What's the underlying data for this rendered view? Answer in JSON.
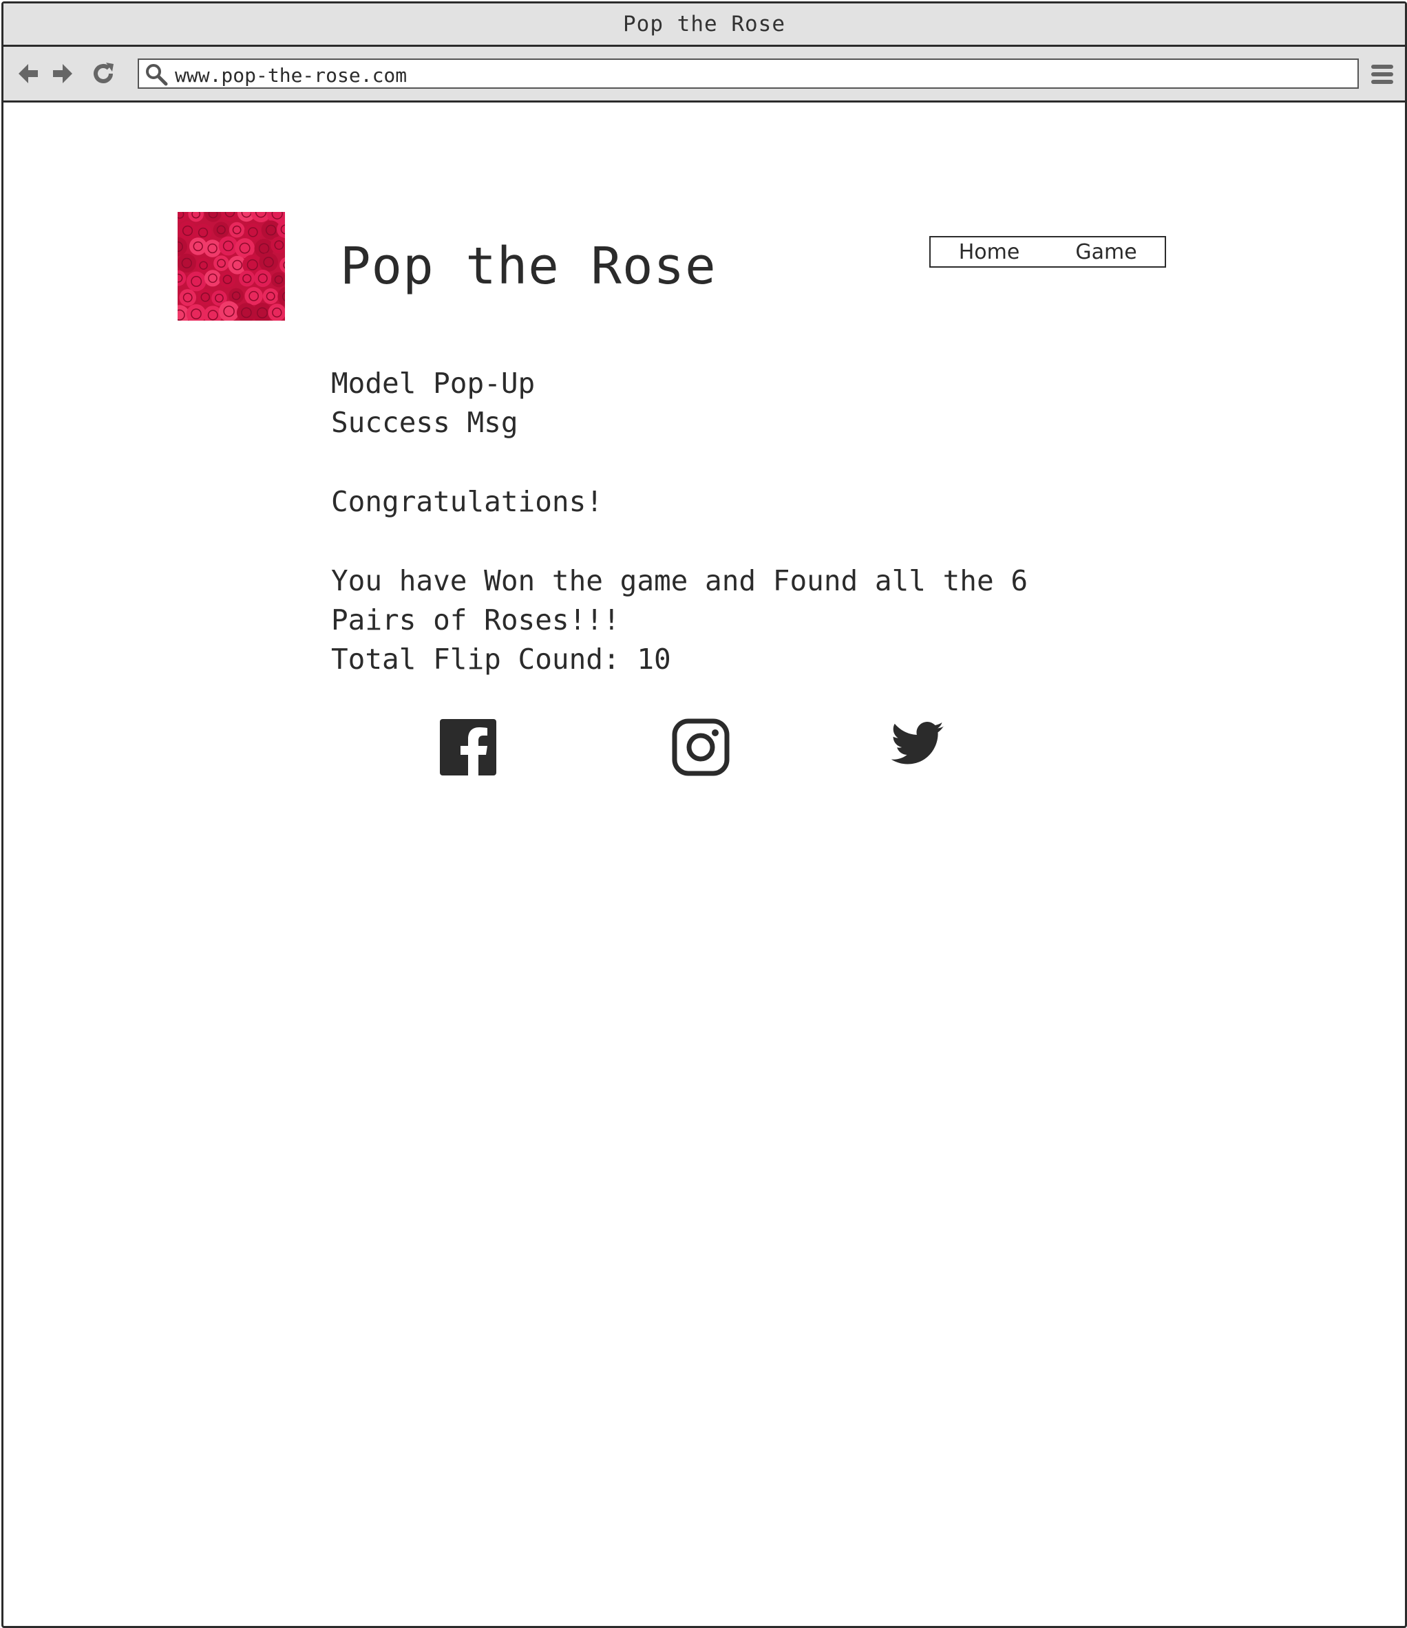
{
  "window": {
    "title": "Pop the Rose"
  },
  "browser": {
    "url": "www.pop-the-rose.com",
    "icons": {
      "back": "arrow-left-icon",
      "forward": "arrow-right-icon",
      "reload": "reload-icon",
      "search": "search-icon",
      "menu": "hamburger-menu-icon"
    }
  },
  "header": {
    "logo": "rose-image",
    "title": "Pop the Rose",
    "nav": [
      {
        "label": "Home"
      },
      {
        "label": "Game"
      }
    ]
  },
  "modal": {
    "heading_line1": "Model Pop-Up",
    "heading_line2": "Success Msg",
    "congrats": "Congratulations!",
    "message_line1": "You have Won the game and Found all the 6",
    "message_line2": "Pairs of Roses!!!",
    "flip_count": "Total Flip Cound: 10"
  },
  "social": [
    {
      "name": "facebook-icon"
    },
    {
      "name": "instagram-icon"
    },
    {
      "name": "twitter-icon"
    }
  ],
  "colors": {
    "chrome": "#e2e2e2",
    "border": "#2b2b2b",
    "text": "#2b2b2b",
    "rose": "#d81b4a"
  }
}
